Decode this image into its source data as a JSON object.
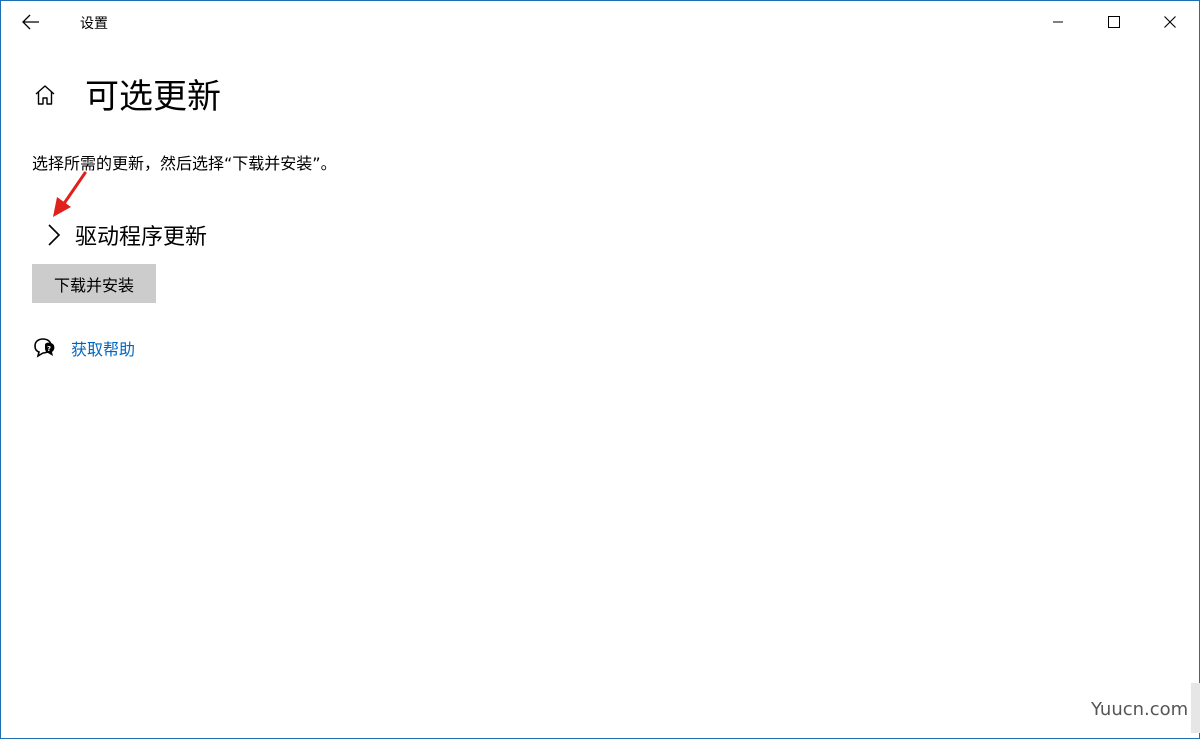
{
  "window": {
    "app_title": "设置",
    "accent_border": "#1f6fb5"
  },
  "header": {
    "title": "可选更新"
  },
  "main": {
    "description": "选择所需的更新，然后选择“下载并安装”。",
    "section": {
      "label": "驱动程序更新",
      "expanded": false
    },
    "install_button_label": "下载并安装",
    "help_link_label": "获取帮助"
  },
  "icons": {
    "back": "back-arrow-icon",
    "home": "home-icon",
    "minimize": "minimize-icon",
    "maximize": "maximize-icon",
    "close": "close-icon",
    "chevron": "chevron-right-icon",
    "help": "help-chat-icon"
  },
  "colors": {
    "link": "#0067c0",
    "button_bg": "#cccccc",
    "annotation": "#e0201b"
  },
  "watermark": "Yuucn.com"
}
